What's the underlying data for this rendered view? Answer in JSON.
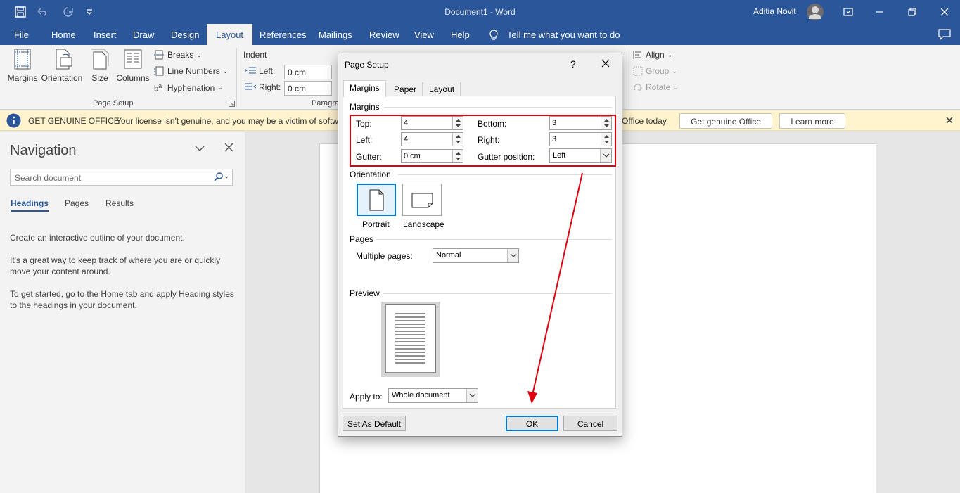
{
  "window": {
    "title": "Document1 - Word",
    "user": "Aditia Novit"
  },
  "tabs": [
    "File",
    "Home",
    "Insert",
    "Draw",
    "Design",
    "Layout",
    "References",
    "Mailings",
    "Review",
    "View",
    "Help"
  ],
  "active_tab": "Layout",
  "tell_me": "Tell me what you want to do",
  "ribbon": {
    "page_setup": {
      "margins": "Margins",
      "orientation": "Orientation",
      "size": "Size",
      "columns": "Columns",
      "breaks": "Breaks",
      "line_numbers": "Line Numbers",
      "hyphenation": "Hyphenation",
      "group_label": "Page Setup"
    },
    "paragraph": {
      "indent": "Indent",
      "left_label": "Left:",
      "left_value": "0 cm",
      "right_label": "Right:",
      "right_value": "0 cm",
      "group_label": "Paragra"
    },
    "arrange": {
      "align": "Align",
      "group": "Group",
      "rotate": "Rotate"
    }
  },
  "genuine_bar": {
    "title": "GET GENUINE OFFICE",
    "message": "Your license isn't genuine, and you may be a victim of softw",
    "message_end": "Office today.",
    "get_button": "Get genuine Office",
    "learn_button": "Learn more"
  },
  "navigation": {
    "title": "Navigation",
    "search_placeholder": "Search document",
    "tabs": [
      "Headings",
      "Pages",
      "Results"
    ],
    "p1": "Create an interactive outline of your document.",
    "p2": "It's a great way to keep track of where you are or quickly move your content around.",
    "p3": "To get started, go to the Home tab and apply Heading styles to the headings in your document."
  },
  "dialog": {
    "title": "Page Setup",
    "help": "?",
    "tabs": [
      "Margins",
      "Paper",
      "Layout"
    ],
    "margins_section": "Margins",
    "top_label": "Top:",
    "top_value": "4",
    "bottom_label": "Bottom:",
    "bottom_value": "3",
    "left_label": "Left:",
    "left_value": "4",
    "right_label": "Right:",
    "right_value": "3",
    "gutter_label": "Gutter:",
    "gutter_value": "0 cm",
    "gutter_pos_label": "Gutter position:",
    "gutter_pos_value": "Left",
    "orientation_section": "Orientation",
    "portrait": "Portrait",
    "landscape": "Landscape",
    "pages_section": "Pages",
    "multiple_pages_label": "Multiple pages:",
    "multiple_pages_value": "Normal",
    "preview_section": "Preview",
    "apply_to_label": "Apply to:",
    "apply_to_value": "Whole document",
    "set_default": "Set As Default",
    "ok": "OK",
    "cancel": "Cancel"
  },
  "colors": {
    "brand": "#2b579a",
    "highlight": "#e0000f"
  }
}
